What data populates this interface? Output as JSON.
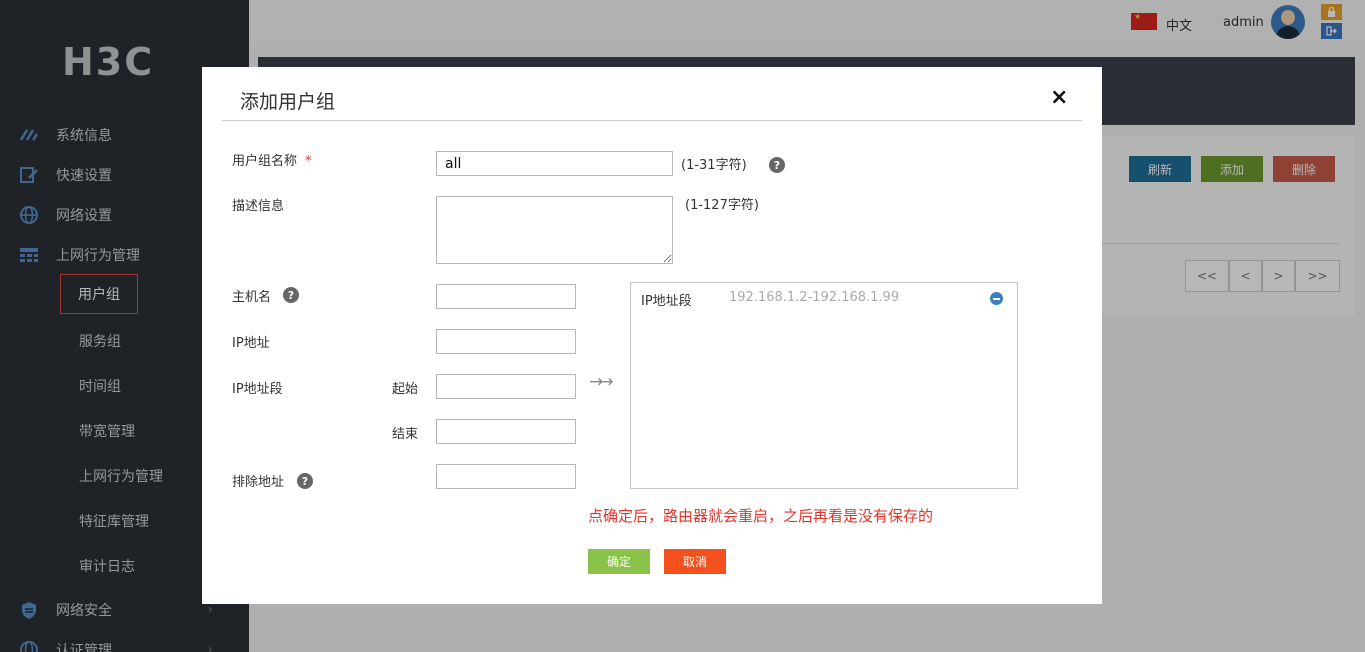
{
  "brand": {
    "logo": "H3C"
  },
  "topbar": {
    "language": "中文",
    "user": "admin"
  },
  "sidebar": {
    "items": [
      {
        "label": "系统信息",
        "icon": "dashboard-icon"
      },
      {
        "label": "快速设置",
        "icon": "edit-icon"
      },
      {
        "label": "网络设置",
        "icon": "globe-icon"
      },
      {
        "label": "上网行为管理",
        "icon": "table-icon"
      },
      {
        "label": "网络安全",
        "icon": "shield-icon"
      },
      {
        "label": "认证管理",
        "icon": "globe-icon"
      }
    ],
    "subitems": [
      {
        "label": "用户组",
        "active": true
      },
      {
        "label": "服务组"
      },
      {
        "label": "时间组"
      },
      {
        "label": "带宽管理"
      },
      {
        "label": "上网行为管理"
      },
      {
        "label": "特征库管理"
      },
      {
        "label": "审计日志"
      }
    ]
  },
  "background": {
    "buttons": {
      "refresh": "刷新",
      "add": "添加",
      "delete": "删除"
    },
    "pager": {
      "first": "<<",
      "prev": "<",
      "next": ">",
      "last": ">>"
    },
    "colors": {
      "refresh": "#1f6f9a",
      "add": "#6c9a2b",
      "delete": "#c75a47"
    }
  },
  "modal": {
    "title": "添加用户组",
    "close": "×",
    "fields": {
      "group_name": {
        "label": "用户组名称",
        "required": "*",
        "value": "all",
        "hint": "(1-31字符)"
      },
      "description": {
        "label": "描述信息",
        "value": "",
        "hint": "(1-127字符)"
      },
      "hostname": {
        "label": "主机名",
        "value": ""
      },
      "ip": {
        "label": "IP地址",
        "value": ""
      },
      "ip_range": {
        "label": "IP地址段",
        "start_label": "起始",
        "end_label": "结束",
        "start_value": "",
        "end_value": ""
      },
      "exclude": {
        "label": "排除地址",
        "value": ""
      }
    },
    "help_glyph": "?",
    "arrows": "→→",
    "list": [
      {
        "type": "IP地址段",
        "value": "192.168.1.2-192.168.1.99"
      }
    ],
    "warning": "点确定后，路由器就会重启，之后再看是没有保存的",
    "ok": "确定",
    "cancel": "取消",
    "colors": {
      "ok": "#8bc34a",
      "cancel": "#f4511e",
      "warning": "#e0342b"
    }
  }
}
